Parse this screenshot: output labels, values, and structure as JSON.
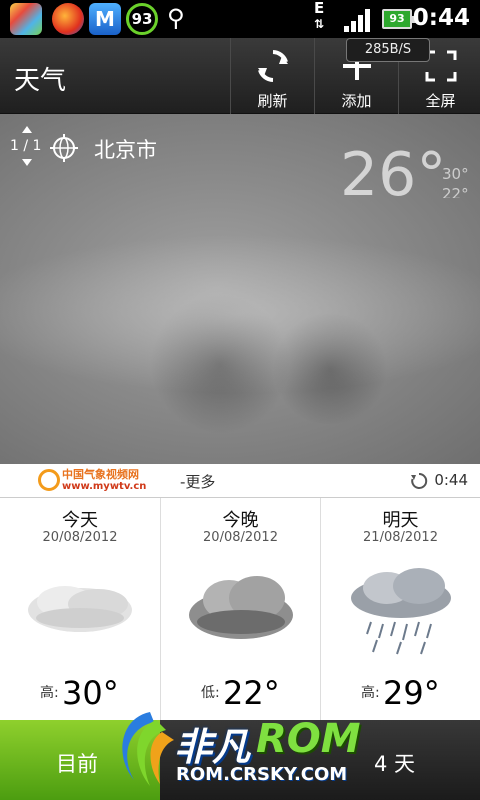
{
  "status_bar": {
    "badge_count": "93",
    "network_type": "E",
    "battery_level": "93",
    "time": "0:44",
    "app3_letter": "M"
  },
  "header": {
    "title": "天气",
    "refresh_label": "刷新",
    "add_label": "添加",
    "fullscreen_label": "全屏",
    "net_speed": "285B/S"
  },
  "location": {
    "page_indicator": "1 / 1",
    "city": "北京市",
    "current_temp": "26°",
    "high": "30°",
    "low": "22°"
  },
  "source": {
    "logo_text": "中国气象视频网",
    "logo_url": "www.mywtv.cn",
    "more_label": "-更多",
    "updated_time": "0:44"
  },
  "forecast": [
    {
      "day": "今天",
      "date": "20/08/2012",
      "temp_label": "高:",
      "temp": "30°",
      "icon": "fog-icon"
    },
    {
      "day": "今晚",
      "date": "20/08/2012",
      "temp_label": "低:",
      "temp": "22°",
      "icon": "cloudy-icon"
    },
    {
      "day": "明天",
      "date": "21/08/2012",
      "temp_label": "高:",
      "temp": "29°",
      "icon": "rain-icon"
    }
  ],
  "bottom_tabs": {
    "left_label": "目前",
    "right_label": "4 天"
  },
  "watermark": {
    "brand_cn": "非凡",
    "brand_en": "ROM",
    "url": "ROM.CRSKY.COM"
  }
}
